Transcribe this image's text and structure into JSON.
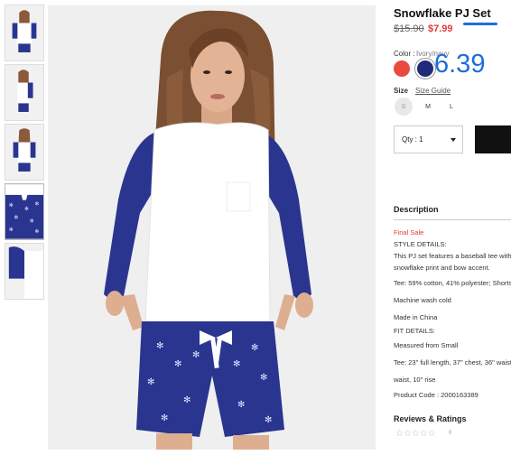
{
  "product": {
    "title": "Snowflake PJ Set",
    "price_original": "$15.90",
    "price_sale": "$7.99"
  },
  "color": {
    "label": "Color :",
    "value": "Ivory/navy",
    "swatches": [
      "red-swatch",
      "navy-swatch"
    ],
    "swatch_colors": {
      "red": "#e84a3e",
      "navy": "#1f2a7a"
    }
  },
  "overlay_number": "6.39",
  "size": {
    "label": "Size",
    "guide": "Size Guide",
    "options": [
      "S",
      "M",
      "L"
    ]
  },
  "qty": {
    "label": "Qty : 1"
  },
  "description": {
    "title": "Description",
    "lines": [
      "Final Sale",
      "STYLE DETAILS:",
      "This PJ set features a baseball tee with",
      "snowflake print and bow accent.",
      "Tee: 59% cotton, 41% polyester; Shorts",
      "Machine wash cold",
      "Made in China",
      "FIT DETAILS:",
      "Measured from Small",
      "Tee: 23\" full length, 37\" chest, 36\" waist",
      "waist, 10\" rise",
      "Product Code : 2000163389"
    ]
  },
  "reviews": {
    "title": "Reviews & Ratings",
    "stars": "☆☆☆☆☆",
    "count": "0"
  },
  "colors": {
    "sale": "#e33b3b",
    "accent_blue": "#1a6fd8",
    "top_white": "#ffffff",
    "sleeve_navy": "#2a3590"
  }
}
